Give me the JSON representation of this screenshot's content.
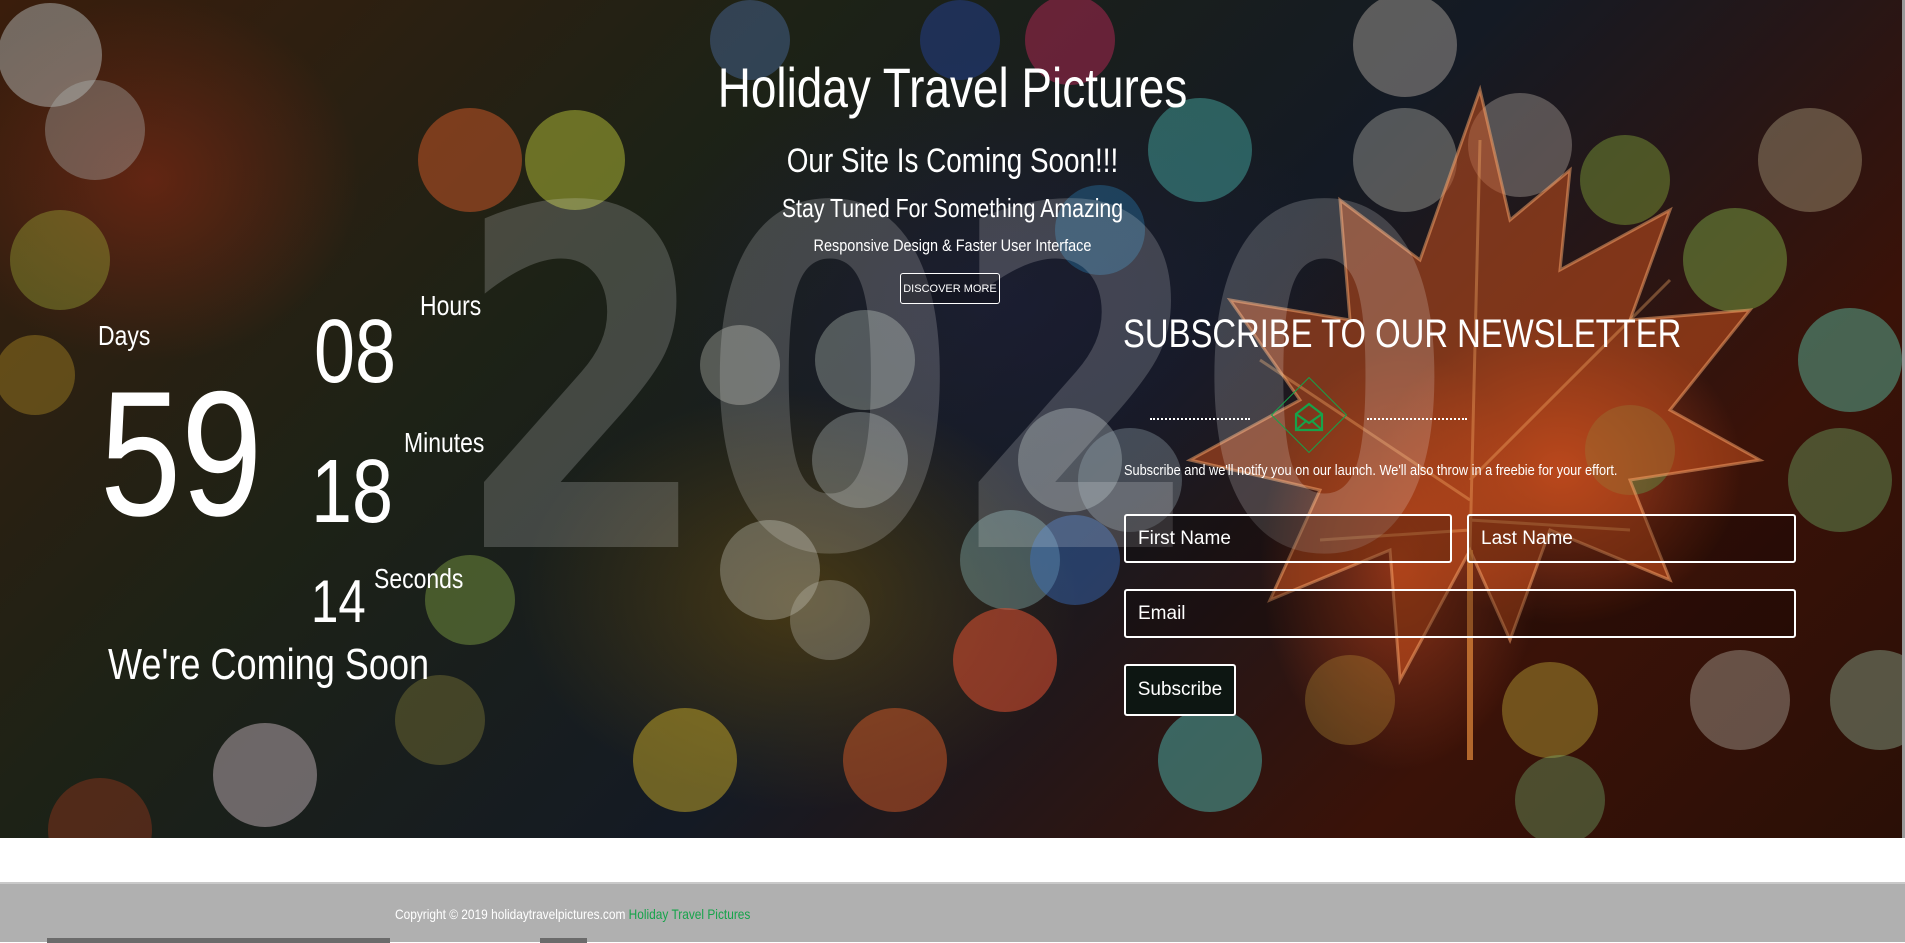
{
  "hero": {
    "title": "Holiday Travel Pictures",
    "tagline": "Our Site Is Coming Soon!!!",
    "subtitle": "Stay Tuned For Something Amazing",
    "feature_line": "Responsive Design & Faster User Interface",
    "discover_label": "DISCOVER MORE",
    "year": "2020"
  },
  "countdown": {
    "days_label": "Days",
    "days_value": "59",
    "hours_label": "Hours",
    "hours_value": "08",
    "minutes_label": "Minutes",
    "minutes_value": "18",
    "seconds_label": "Seconds",
    "seconds_value": "14",
    "coming_text": "We're Coming Soon"
  },
  "newsletter": {
    "title": "SUBSCRIBE TO OUR NEWSLETTER",
    "icon": "envelope-open-icon",
    "description": "Subscribe and we'll notify you on our launch. We'll also throw in a freebie for your effort.",
    "first_name_placeholder": "First Name",
    "last_name_placeholder": "Last Name",
    "email_placeholder": "Email",
    "subscribe_label": "Subscribe"
  },
  "footer": {
    "copyright": "Copyright © 2019 holidaytravelpictures.com",
    "brand": "Holiday Travel Pictures"
  },
  "colors": {
    "accent": "#16a34a",
    "footer_bg": "#b0b0b0",
    "text": "#ffffff"
  }
}
